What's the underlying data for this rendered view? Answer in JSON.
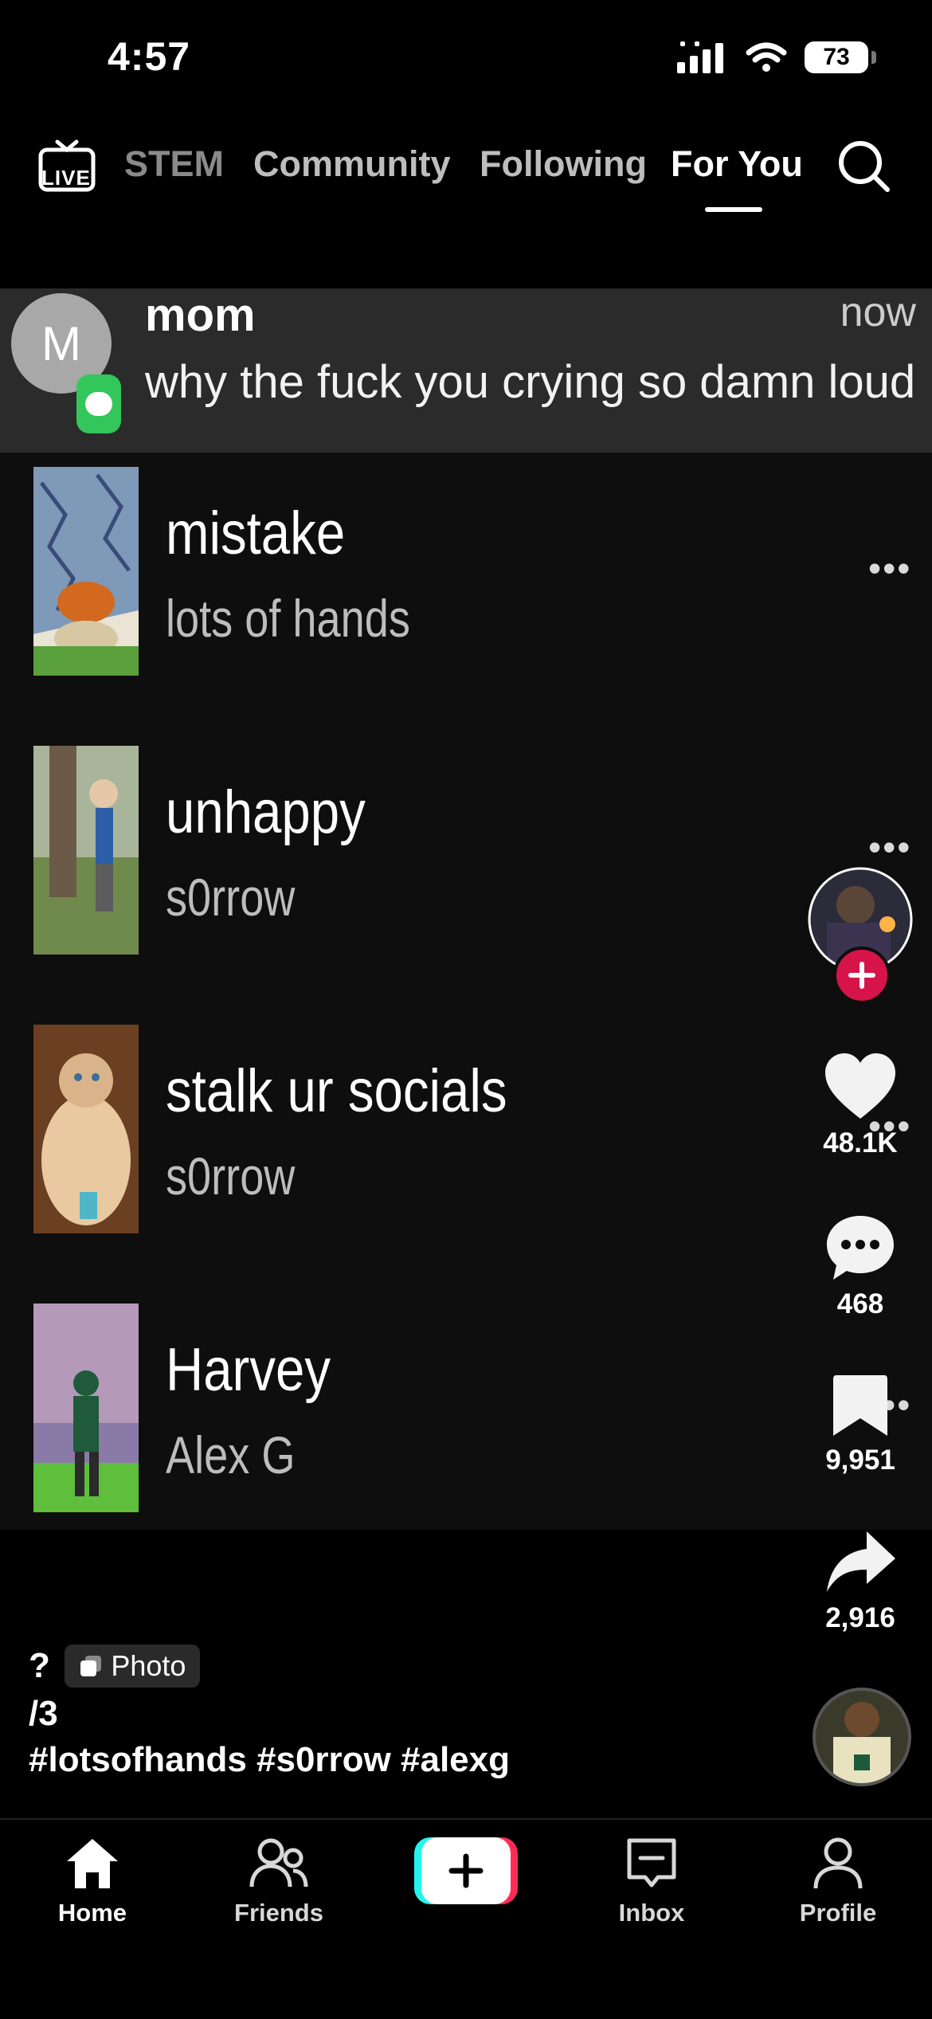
{
  "status_bar": {
    "time": "4:57",
    "battery": "73"
  },
  "top_nav": {
    "live_label": "LIVE",
    "tabs": [
      "STEM",
      "Community",
      "Following",
      "For You"
    ],
    "active_tab": "For You"
  },
  "notification": {
    "avatar_letter": "M",
    "sender": "mom",
    "time": "now",
    "message": "why the fuck you crying so damn loud"
  },
  "tracks": [
    {
      "title": "mistake",
      "artist": "lots of hands",
      "more": "•••"
    },
    {
      "title": "unhappy",
      "artist": "s0rrow",
      "more": "•••"
    },
    {
      "title": "stalk ur socials",
      "artist": "s0rrow",
      "more": "•••"
    },
    {
      "title": "Harvey",
      "artist": "Alex G",
      "more": "•••"
    }
  ],
  "actions": {
    "likes": "48.1K",
    "comments": "468",
    "bookmarks": "9,951",
    "shares": "2,916"
  },
  "caption": {
    "question": "?",
    "photo_chip": "Photo",
    "page": "/3",
    "hashtags": "#lotsofhands #s0rrow #alexg"
  },
  "bottom_nav": {
    "home": "Home",
    "friends": "Friends",
    "inbox": "Inbox",
    "profile": "Profile"
  },
  "colors": {
    "accent_red": "#d7144a",
    "cyan": "#25f4ee",
    "pink": "#fe2c55",
    "notif_green": "#33c65a"
  }
}
